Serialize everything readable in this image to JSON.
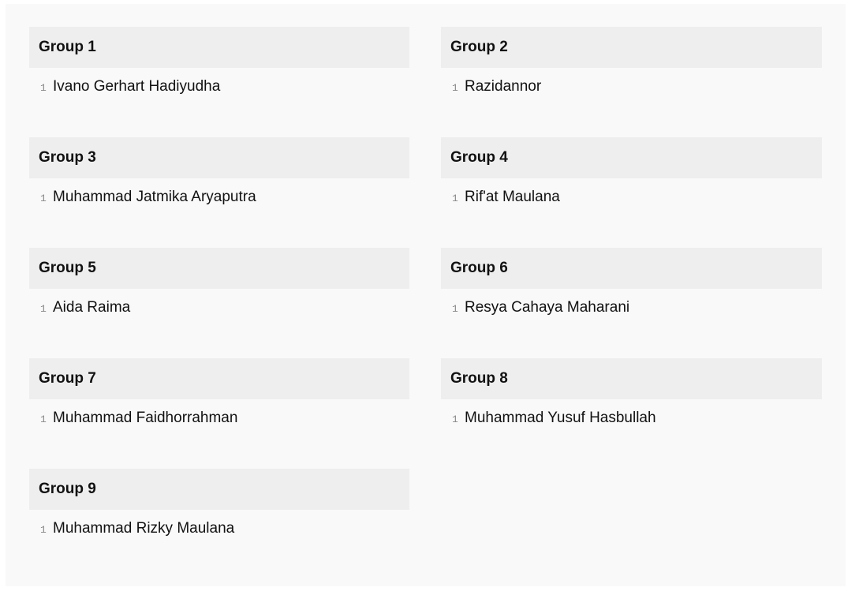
{
  "groups": [
    {
      "title": "Group 1",
      "members": [
        {
          "index": "1",
          "name": "Ivano Gerhart Hadiyudha"
        }
      ]
    },
    {
      "title": "Group 2",
      "members": [
        {
          "index": "1",
          "name": "Razidannor"
        }
      ]
    },
    {
      "title": "Group 3",
      "members": [
        {
          "index": "1",
          "name": "Muhammad Jatmika Aryaputra"
        }
      ]
    },
    {
      "title": "Group 4",
      "members": [
        {
          "index": "1",
          "name": "Rif'at Maulana"
        }
      ]
    },
    {
      "title": "Group 5",
      "members": [
        {
          "index": "1",
          "name": "Aida Raima"
        }
      ]
    },
    {
      "title": "Group 6",
      "members": [
        {
          "index": "1",
          "name": "Resya Cahaya Maharani"
        }
      ]
    },
    {
      "title": "Group 7",
      "members": [
        {
          "index": "1",
          "name": "Muhammad Faidhorrahman"
        }
      ]
    },
    {
      "title": "Group 8",
      "members": [
        {
          "index": "1",
          "name": "Muhammad Yusuf Hasbullah"
        }
      ]
    },
    {
      "title": "Group 9",
      "members": [
        {
          "index": "1",
          "name": "Muhammad Rizky Maulana"
        }
      ]
    }
  ]
}
